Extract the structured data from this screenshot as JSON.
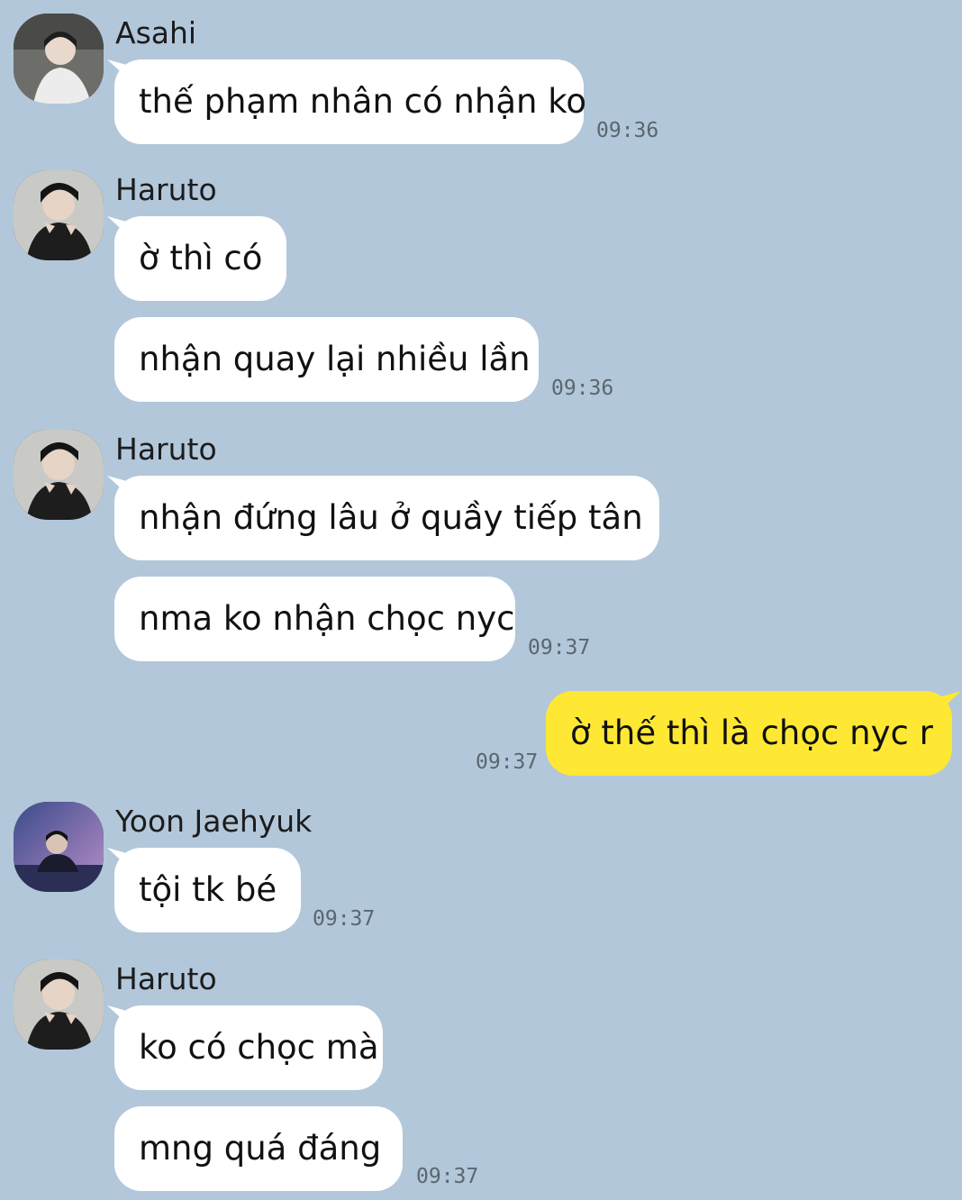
{
  "messages": [
    {
      "sender": "Asahi",
      "avatar": "asahi-avatar",
      "texts": [
        "thế phạm nhân có nhận ko"
      ],
      "time": "09:36"
    },
    {
      "sender": "Haruto",
      "avatar": "haruto-avatar",
      "texts": [
        "ờ thì có",
        "nhận quay lại nhiều lần"
      ],
      "time": "09:36"
    },
    {
      "sender": "Haruto",
      "avatar": "haruto-avatar",
      "texts": [
        "nhận đứng lâu ở quầy tiếp tân",
        "nma ko nhận chọc nyc"
      ],
      "time": "09:37"
    },
    {
      "sender": "me",
      "texts": [
        "ờ thế thì là chọc nyc r"
      ],
      "time": "09:37"
    },
    {
      "sender": "Yoon Jaehyuk",
      "avatar": "jaehyuk-avatar",
      "texts": [
        "tội tk bé"
      ],
      "time": "09:37"
    },
    {
      "sender": "Haruto",
      "avatar": "haruto-avatar",
      "texts": [
        "ko có chọc mà",
        "mng quá đáng"
      ],
      "time": "09:37"
    }
  ],
  "colors": {
    "background": "#b2c7da",
    "incoming_bubble": "#ffffff",
    "outgoing_bubble": "#fee834"
  }
}
